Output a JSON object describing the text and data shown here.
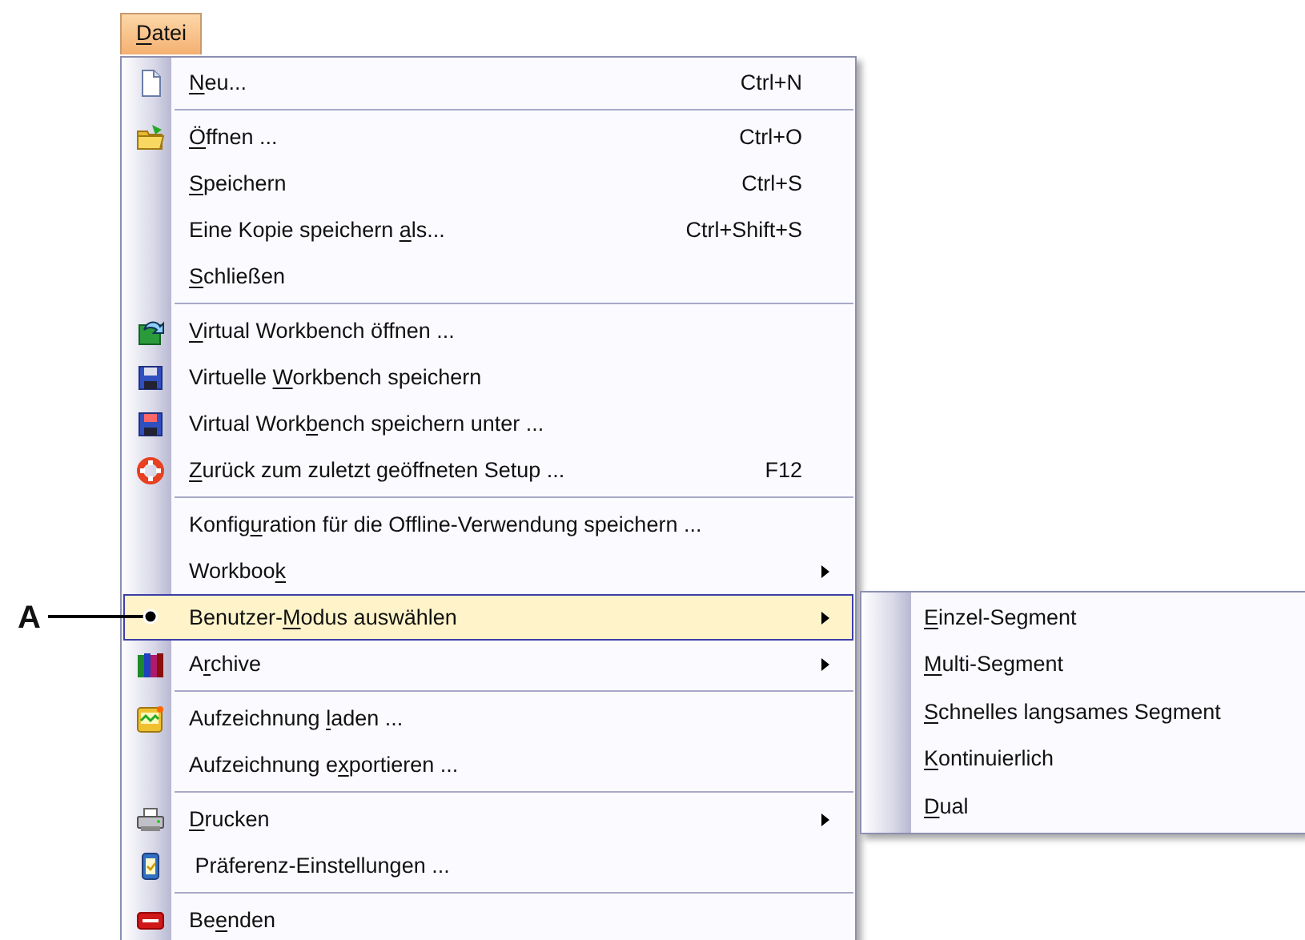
{
  "menu_header": {
    "key": "D",
    "post": "atei",
    "selected": true
  },
  "items": [
    {
      "kind": "item",
      "key": "N",
      "post": "eu...",
      "shortcut": "Ctrl+N",
      "has_submenu": false,
      "selected": false
    },
    {
      "kind": "separator"
    },
    {
      "kind": "item",
      "key": "Ö",
      "post": "ffnen ...",
      "shortcut": "Ctrl+O",
      "has_submenu": false,
      "selected": false
    },
    {
      "kind": "item",
      "key": "S",
      "post": "peichern",
      "shortcut": "Ctrl+S",
      "has_submenu": false,
      "selected": false
    },
    {
      "kind": "item",
      "pre": "Eine Kopie speichern ",
      "key": "a",
      "post": "ls...",
      "shortcut": "Ctrl+Shift+S",
      "has_submenu": false,
      "selected": false
    },
    {
      "kind": "item",
      "key": "S",
      "post": "chließen",
      "has_submenu": false,
      "selected": false
    },
    {
      "kind": "separator"
    },
    {
      "kind": "item",
      "key": "V",
      "post": "irtual Workbench öffnen ...",
      "has_submenu": false,
      "selected": false
    },
    {
      "kind": "item",
      "pre": "Virtuelle ",
      "key": "W",
      "post": "orkbench speichern",
      "has_submenu": false,
      "selected": false
    },
    {
      "kind": "item",
      "pre": "Virtual Work",
      "key": "b",
      "post": "ench speichern unter ...",
      "has_submenu": false,
      "selected": false
    },
    {
      "kind": "item",
      "key": "Z",
      "post": "urück zum zuletzt geöffneten Setup ...",
      "shortcut": "F12",
      "has_submenu": false,
      "selected": false
    },
    {
      "kind": "separator"
    },
    {
      "kind": "item",
      "pre": "Konfig",
      "key": "u",
      "post": "ration für die Offline-Verwendung speichern ...",
      "has_submenu": false,
      "selected": false
    },
    {
      "kind": "item",
      "pre": "Workboo",
      "key": "k",
      "has_submenu": true,
      "selected": false
    },
    {
      "kind": "item",
      "pre": "Benutzer-",
      "key": "M",
      "post": "odus auswählen",
      "has_submenu": true,
      "selected": true
    },
    {
      "kind": "item",
      "pre": "A",
      "key": "r",
      "post": "chive",
      "has_submenu": true,
      "selected": false
    },
    {
      "kind": "separator"
    },
    {
      "kind": "item",
      "pre": "Aufzeichnung ",
      "key": "l",
      "post": "aden ...",
      "has_submenu": false,
      "selected": false
    },
    {
      "kind": "item",
      "pre": "Aufzeichnung e",
      "key": "x",
      "post": "portieren ...",
      "has_submenu": false,
      "selected": false
    },
    {
      "kind": "separator"
    },
    {
      "kind": "item",
      "key": "D",
      "post": "rucken",
      "has_submenu": true,
      "selected": false
    },
    {
      "kind": "item",
      "pre": " Präferenz-Einstellungen ...",
      "has_submenu": false,
      "selected": false
    },
    {
      "kind": "separator"
    },
    {
      "kind": "item",
      "pre": "Be",
      "key": "e",
      "post": "nden",
      "has_submenu": false,
      "selected": false
    }
  ],
  "submenu": [
    {
      "key": "E",
      "post": "inzel-Segment"
    },
    {
      "key": "M",
      "post": "ulti-Segment"
    },
    {
      "key": "S",
      "post": "chnelles langsames Segment"
    },
    {
      "key": "K",
      "post": "ontinuierlich"
    },
    {
      "key": "D",
      "post": "ual"
    }
  ],
  "callout": {
    "label": "A"
  }
}
